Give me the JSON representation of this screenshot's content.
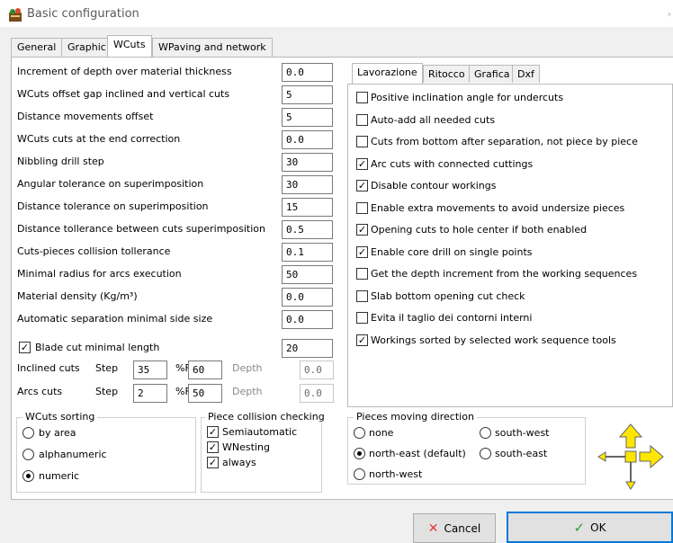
{
  "window": {
    "title": "Basic configuration",
    "close_glyph": "›"
  },
  "tabs": [
    "General",
    "Graphic",
    "WCuts",
    "WPaving and network"
  ],
  "active_tab": "WCuts",
  "params": [
    {
      "label": "Increment of depth over material thickness",
      "value": "0.0"
    },
    {
      "label": "WCuts offset gap inclined and vertical cuts",
      "value": "5"
    },
    {
      "label": "Distance movements offset",
      "value": "5"
    },
    {
      "label": "WCuts cuts at the end correction",
      "value": "0.0"
    },
    {
      "label": "Nibbling drill step",
      "value": "30"
    },
    {
      "label": "Angular tolerance on superimposition",
      "value": "30"
    },
    {
      "label": "Distance tolerance on superimposition",
      "value": "15"
    },
    {
      "label": "Distance tollerance between cuts superimposition",
      "value": "0.5"
    },
    {
      "label": "Cuts-pieces collision tollerance",
      "value": "0.1"
    },
    {
      "label": "Minimal radius for arcs execution",
      "value": "50"
    },
    {
      "label": "Material density (Kg/m³)",
      "value": "0.0"
    },
    {
      "label": "Automatic separation minimal side size",
      "value": "0.0"
    }
  ],
  "blade": {
    "label": "Blade cut minimal length",
    "checked": true,
    "value": "20"
  },
  "step_rows": [
    {
      "label": "Inclined cuts",
      "step_label": "Step",
      "step": "35",
      "pct_label": "%F",
      "pct": "60",
      "depth_label": "Depth",
      "depth": "0.0"
    },
    {
      "label": "Arcs cuts",
      "step_label": "Step",
      "step": "2",
      "pct_label": "%F",
      "pct": "50",
      "depth_label": "Depth",
      "depth": "0.0"
    }
  ],
  "subtabs": [
    "Lavorazione",
    "Ritocco",
    "Grafica",
    "Dxf"
  ],
  "active_subtab": "Lavorazione",
  "options": [
    {
      "label": "Positive inclination angle for undercuts",
      "checked": false
    },
    {
      "label": "Auto-add all needed cuts",
      "checked": false
    },
    {
      "label": "Cuts from bottom after separation, not piece by piece",
      "checked": false
    },
    {
      "label": "Arc cuts with connected cuttings",
      "checked": true
    },
    {
      "label": "Disable contour workings",
      "checked": true
    },
    {
      "label": "Enable extra movements to avoid undersize pieces",
      "checked": false
    },
    {
      "label": "Opening cuts to hole center if both enabled",
      "checked": true
    },
    {
      "label": "Enable core drill on single points",
      "checked": true
    },
    {
      "label": "Get the depth increment from the working sequences",
      "checked": false
    },
    {
      "label": "Slab bottom opening cut check",
      "checked": false
    },
    {
      "label": "Evita il taglio dei contorni interni",
      "checked": false
    },
    {
      "label": "Workings sorted by selected work sequence tools",
      "checked": true
    }
  ],
  "sorting": {
    "title": "WCuts sorting",
    "options": [
      "by area",
      "alphanumeric",
      "numeric"
    ],
    "selected": "numeric"
  },
  "collision": {
    "title": "Piece collision checking",
    "options": [
      {
        "label": "Semiautomatic",
        "checked": true
      },
      {
        "label": "WNesting",
        "checked": true
      },
      {
        "label": "always",
        "checked": true
      }
    ]
  },
  "moving": {
    "title": "Pieces moving direction",
    "options": [
      "none",
      "south-west",
      "north-east (default)",
      "south-east",
      "north-west"
    ],
    "selected": "north-east (default)"
  },
  "buttons": {
    "cancel": "Cancel",
    "ok": "OK"
  },
  "colors": {
    "accent": "#0078d7",
    "arrow_yellow": "#ffe600",
    "cancel_red": "#e53935",
    "ok_green": "#2e9e3f"
  }
}
